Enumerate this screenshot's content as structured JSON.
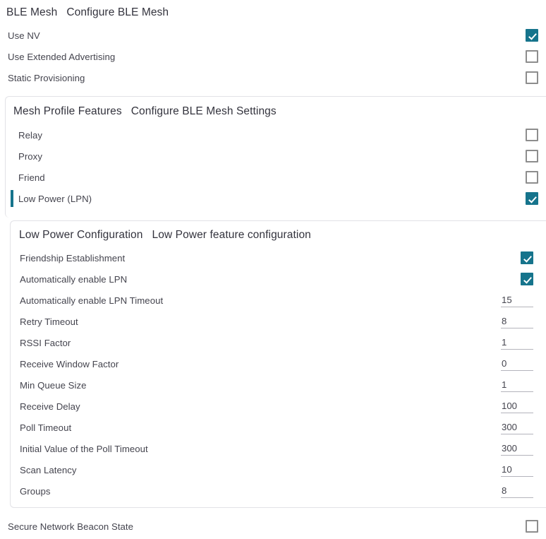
{
  "theme": {
    "accent": "#16748c",
    "checkbox_border": "#8d8d8d",
    "panel_border": "#e2e2e6",
    "label_color": "#44444e",
    "header_color": "#33333d"
  },
  "root_section": {
    "title": "BLE Mesh",
    "description": "Configure BLE Mesh",
    "rows": [
      {
        "label": "Use NV",
        "type": "checkbox",
        "checked": true
      },
      {
        "label": "Use Extended Advertising",
        "type": "checkbox",
        "checked": false
      },
      {
        "label": "Static Provisioning",
        "type": "checkbox",
        "checked": false
      }
    ]
  },
  "mesh_profile_features": {
    "title": "Mesh Profile Features",
    "description": "Configure BLE Mesh Settings",
    "rows": [
      {
        "label": "Relay",
        "type": "checkbox",
        "checked": false,
        "active": false
      },
      {
        "label": "Proxy",
        "type": "checkbox",
        "checked": false,
        "active": false
      },
      {
        "label": "Friend",
        "type": "checkbox",
        "checked": false,
        "active": false
      },
      {
        "label": "Low Power (LPN)",
        "type": "checkbox",
        "checked": true,
        "active": true
      }
    ]
  },
  "low_power_configuration": {
    "title": "Low Power Configuration",
    "description": "Low Power feature configuration",
    "rows": [
      {
        "label": "Friendship Establishment",
        "type": "checkbox",
        "checked": true
      },
      {
        "label": "Automatically enable LPN",
        "type": "checkbox",
        "checked": true
      },
      {
        "label": "Automatically enable LPN Timeout",
        "type": "number",
        "value": "15"
      },
      {
        "label": "Retry Timeout",
        "type": "number",
        "value": "8"
      },
      {
        "label": "RSSI Factor",
        "type": "number",
        "value": "1"
      },
      {
        "label": "Receive Window Factor",
        "type": "number",
        "value": "0"
      },
      {
        "label": "Min Queue Size",
        "type": "number",
        "value": "1"
      },
      {
        "label": "Receive Delay",
        "type": "number",
        "value": "100"
      },
      {
        "label": "Poll Timeout",
        "type": "number",
        "value": "300"
      },
      {
        "label": "Initial Value of the Poll Timeout",
        "type": "number",
        "value": "300"
      },
      {
        "label": "Scan Latency",
        "type": "number",
        "value": "10"
      },
      {
        "label": "Groups",
        "type": "number",
        "value": "8"
      }
    ]
  },
  "trailing_rows": [
    {
      "label": "Secure Network Beacon State",
      "type": "checkbox",
      "checked": false
    }
  ]
}
